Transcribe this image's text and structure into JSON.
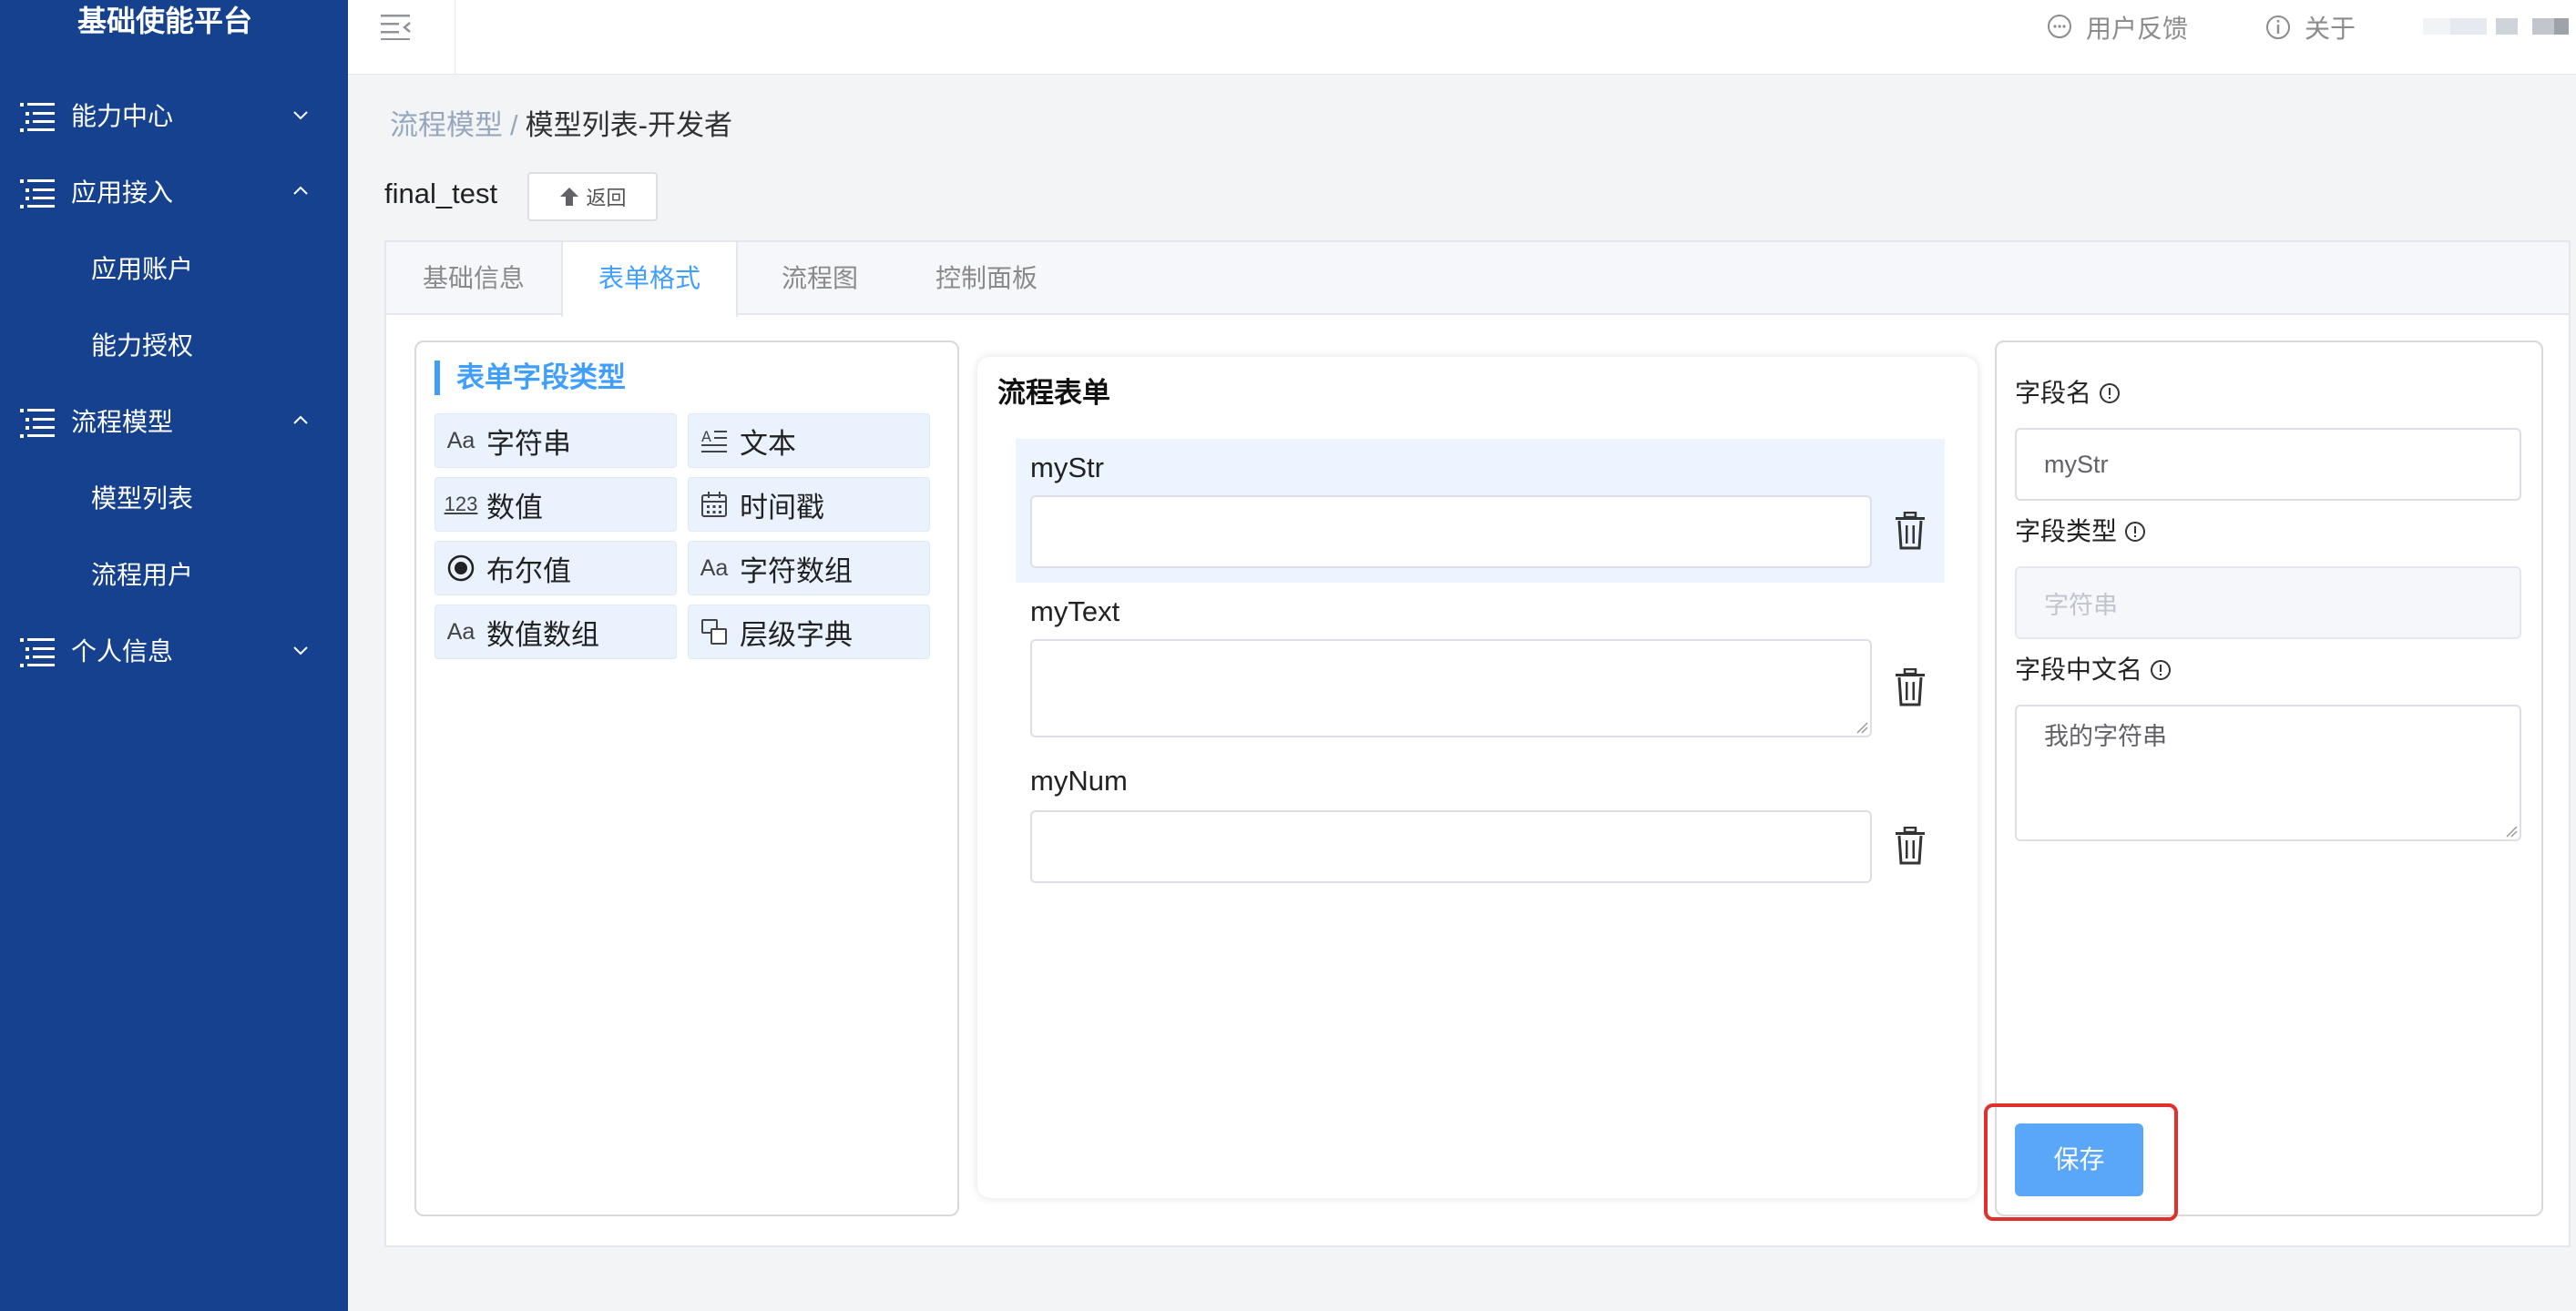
{
  "sidebar": {
    "brand": "基础使能平台",
    "menus": [
      {
        "label": "能力中心",
        "expanded": false
      },
      {
        "label": "应用接入",
        "expanded": true,
        "children": [
          "应用账户",
          "能力授权"
        ]
      },
      {
        "label": "流程模型",
        "expanded": true,
        "children": [
          "模型列表",
          "流程用户"
        ]
      },
      {
        "label": "个人信息",
        "expanded": false
      }
    ]
  },
  "header": {
    "feedback": "用户反馈",
    "about": "关于"
  },
  "breadcrumb": {
    "parent": "流程模型",
    "separator": "/",
    "current": "模型列表-开发者"
  },
  "model": {
    "name": "final_test",
    "back_label": "返回"
  },
  "tabs": [
    {
      "label": "基础信息",
      "active": false
    },
    {
      "label": "表单格式",
      "active": true
    },
    {
      "label": "流程图",
      "active": false
    },
    {
      "label": "控制面板",
      "active": false
    }
  ],
  "field_types": {
    "title": "表单字段类型",
    "items": [
      {
        "label": "字符串",
        "icon": "Aa"
      },
      {
        "label": "文本",
        "icon": "text-lines-icon"
      },
      {
        "label": "数值",
        "icon": "123"
      },
      {
        "label": "时间戳",
        "icon": "calendar-icon"
      },
      {
        "label": "布尔值",
        "icon": "radio-icon"
      },
      {
        "label": "字符数组",
        "icon": "Aa"
      },
      {
        "label": "数值数组",
        "icon": "Aa"
      },
      {
        "label": "层级字典",
        "icon": "hierarchy-icon"
      }
    ]
  },
  "form": {
    "title": "流程表单",
    "fields": [
      {
        "name": "myStr",
        "value": ""
      },
      {
        "name": "myText",
        "value": ""
      },
      {
        "name": "myNum",
        "value": ""
      }
    ]
  },
  "properties": {
    "field_name_label": "字段名",
    "field_name_value": "myStr",
    "field_type_label": "字段类型",
    "field_type_value": "字符串",
    "field_cn_label": "字段中文名",
    "field_cn_value": "我的字符串",
    "save_label": "保存"
  },
  "colors": {
    "sidebar": "#15418f",
    "accent": "#409eff",
    "highlight": "#e0302a"
  }
}
